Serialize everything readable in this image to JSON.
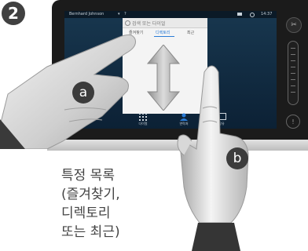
{
  "step": "2",
  "screen": {
    "user": "Bernhard Johnson",
    "caret": "▾",
    "help_glyph": "?",
    "clock": "14:37",
    "search_placeholder": "검색 또는 다이얼",
    "tabs": [
      "즐겨찾기",
      "디렉토리",
      "최근"
    ],
    "active_tab_index": 1,
    "bottom_icons": [
      {
        "icon": "keypad-icon",
        "label": "다이얼"
      },
      {
        "icon": "contacts-icon",
        "label": "연락처"
      },
      {
        "icon": "share-icon",
        "label": "공유"
      }
    ],
    "side_mic_glyph": "✂",
    "side_help_glyph": "!"
  },
  "callouts": {
    "a": "a",
    "b": "b"
  },
  "caption": [
    "특정 목록",
    "(즐겨찾기,",
    "디렉토리",
    "또는 최근)"
  ],
  "colors": {
    "badge": "#404040",
    "active_tab": "#2a7bd6",
    "arrow": "#bdbdbd"
  }
}
